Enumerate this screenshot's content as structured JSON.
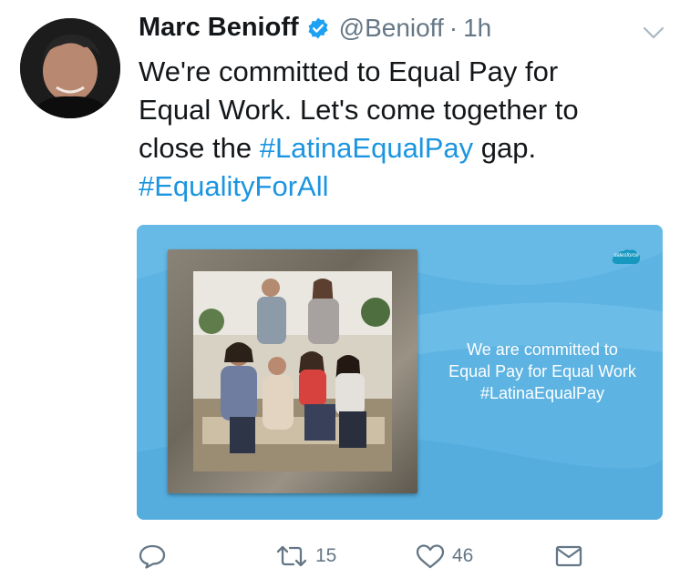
{
  "user": {
    "name": "Marc Benioff",
    "handle": "@Benioff",
    "separator": "·",
    "time": "1h",
    "avatar_icon": "profile-photo"
  },
  "tweet": {
    "line1": "We're committed to Equal Pay for",
    "line2": "Equal Work. Let's come together to",
    "line3_before": "close the ",
    "hashtag1": "#LatinaEqualPay",
    "line3_after": " gap.",
    "hashtag2": "#EqualityForAll"
  },
  "media": {
    "brand": "salesforce",
    "message_line1": "We are committed to",
    "message_line2": "Equal Pay for Equal Work",
    "message_line3": "#LatinaEqualPay"
  },
  "actions": {
    "reply_icon": "reply-icon",
    "retweet_icon": "retweet-icon",
    "retweet_count": "15",
    "like_icon": "heart-icon",
    "like_count": "46",
    "message_icon": "envelope-icon"
  },
  "colors": {
    "link": "#1b95e0",
    "secondary": "#657786",
    "text": "#14171a",
    "media_bg": "#5db3e2"
  }
}
